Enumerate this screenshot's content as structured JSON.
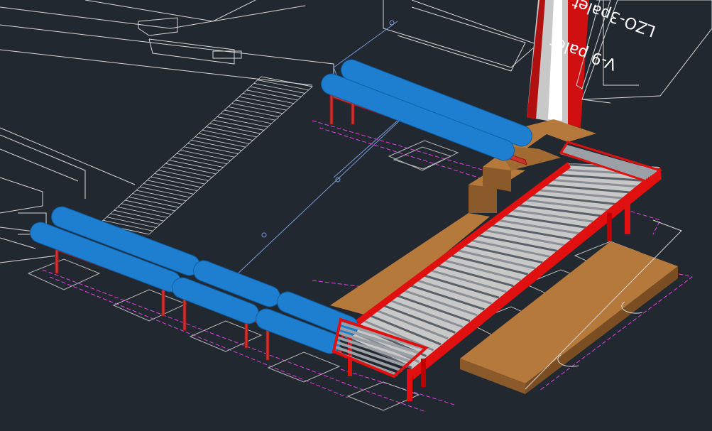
{
  "canvas": {
    "background": "#212830"
  },
  "labels": {
    "pallet_v9": "V-9 palet",
    "pallet_lzo3": "LZO-3palet"
  },
  "colors": {
    "roller_blue": "#1E7FD0",
    "frame_red": "#E01010",
    "wood_brown": "#B5793C",
    "wood_dark": "#8A5A2A",
    "roller_grey": "#9AA0A6",
    "wire_white": "#D8D8D8",
    "wire_magenta": "#E040E0",
    "column_grey": "#C8C8C8"
  }
}
